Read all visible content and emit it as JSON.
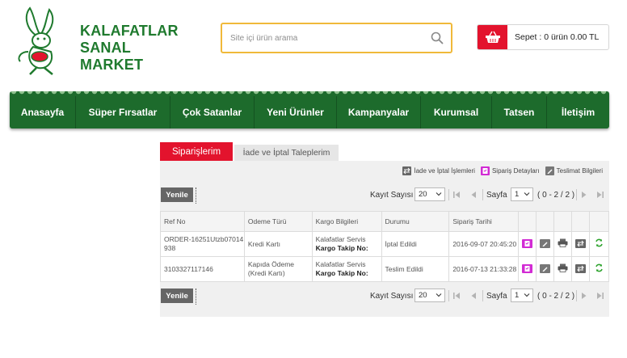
{
  "brand": {
    "line1": "KALAFATLAR",
    "line2": "SANAL MARKET",
    "green": "#1f7a2e",
    "accent_red": "#e3132d"
  },
  "search": {
    "placeholder": "Site içi ürün arama",
    "value": ""
  },
  "cart": {
    "label": "Sepet : 0 ürün 0.00 TL",
    "icon": "basket-icon"
  },
  "nav": {
    "items": [
      {
        "label": "Anasayfa"
      },
      {
        "label": "Süper Fırsatlar"
      },
      {
        "label": "Çok Satanlar"
      },
      {
        "label": "Yeni Ürünler"
      },
      {
        "label": "Kampanyalar"
      },
      {
        "label": "Kurumsal"
      },
      {
        "label": "Tatsen"
      },
      {
        "label": "İletişim"
      }
    ]
  },
  "tabs": {
    "active": "Siparişlerim",
    "inactive": "İade ve İptal Taleplerim"
  },
  "legend": {
    "return": "İade ve İptal İşlemleri",
    "details": "Sipariş Detayları",
    "delivery": "Teslimat Bilgileri"
  },
  "pager": {
    "refresh": "Yenile",
    "records_label": "Kayıt Sayısı",
    "records_value": "20",
    "page_label": "Sayfa",
    "page_value": "1",
    "page_info": "( 0 - 2 / 2 )"
  },
  "table": {
    "headers": {
      "ref": "Ref No",
      "payment": "Odeme Türü",
      "shipping": "Kargo Bilgileri",
      "status": "Durumu",
      "date": "Sipariş Tarihi"
    },
    "rows": [
      {
        "ref": "ORDER-16251Utzb07014938",
        "payment": "Kredi Kartı",
        "carrier": "Kalafatlar Servis",
        "tracking_label": "Kargo Takip No:",
        "status": "İptal Edildi",
        "date": "2016-09-07 20:45:20"
      },
      {
        "ref": "3103327117146",
        "payment": "Kapıda Ödeme (Kredi Kartı)",
        "carrier": "Kalafatlar Servis",
        "tracking_label": "Kargo Takip No:",
        "status": "Teslim Edildi",
        "date": "2016-07-13 21:33:28"
      }
    ]
  }
}
